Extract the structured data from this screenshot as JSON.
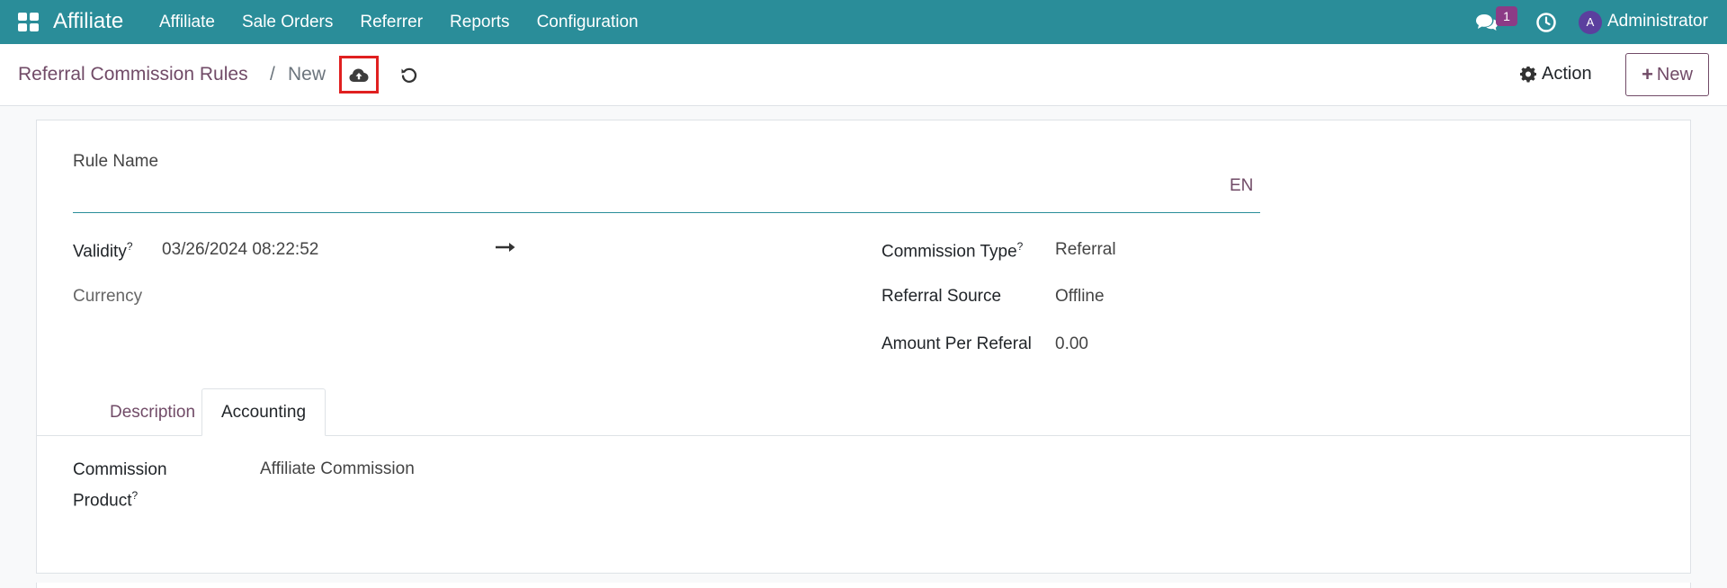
{
  "navbar": {
    "app_name": "Affiliate",
    "menu": [
      "Affiliate",
      "Sale Orders",
      "Referrer",
      "Reports",
      "Configuration"
    ],
    "message_count": "1",
    "user_initial": "A",
    "user_name": "Administrator"
  },
  "control_panel": {
    "breadcrumb_parent": "Referral Commission Rules",
    "breadcrumb_separator": "/",
    "breadcrumb_current": "New",
    "action_label": "Action",
    "new_label": "New"
  },
  "form": {
    "rule_name_label": "Rule Name",
    "rule_name_value": "",
    "lang": "EN",
    "validity_label": "Validity",
    "validity_help": "?",
    "validity_value": "03/26/2024 08:22:52",
    "currency_label": "Currency",
    "commission_type_label": "Commission Type",
    "commission_type_help": "?",
    "commission_type_value": "Referral",
    "referral_source_label": "Referral Source",
    "referral_source_value": "Offline",
    "amount_label": "Amount Per Referal",
    "amount_value": "0.00",
    "tabs": [
      "Description",
      "Accounting"
    ],
    "commission_product_label_1": "Commission",
    "commission_product_label_2": "Product",
    "commission_product_help": "?",
    "commission_product_value": "Affiliate Commission"
  },
  "colors": {
    "navbar": "#2a8d99",
    "brand": "#714b67",
    "save_highlight": "#e02020"
  }
}
